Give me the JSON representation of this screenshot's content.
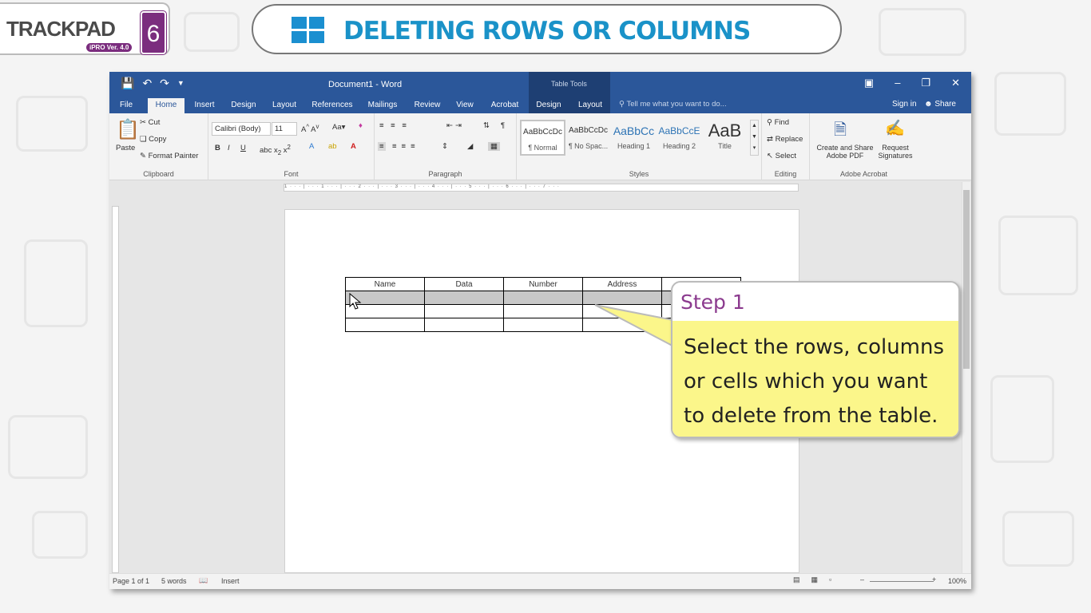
{
  "logo": {
    "brand": "TRACKPAD",
    "sub": "iPRO Ver. 4.0",
    "number": "6"
  },
  "lesson_title": "DELETING ROWS OR COLUMNS",
  "word": {
    "doc_title": "Document1 - Word",
    "contextual_label": "Table Tools",
    "tabs": [
      "File",
      "Home",
      "Insert",
      "Design",
      "Layout",
      "References",
      "Mailings",
      "Review",
      "View",
      "Acrobat",
      "Design",
      "Layout"
    ],
    "tell_me": "Tell me what you want to do...",
    "sign_in": "Sign in",
    "share": "Share",
    "clipboard": {
      "paste": "Paste",
      "cut": "Cut",
      "copy": "Copy",
      "format_painter": "Format Painter",
      "label": "Clipboard"
    },
    "font": {
      "name": "Calibri (Body)",
      "size": "11",
      "label": "Font"
    },
    "paragraph": {
      "label": "Paragraph"
    },
    "styles": {
      "items": [
        {
          "preview": "AaBbCcDc",
          "name": "¶ Normal"
        },
        {
          "preview": "AaBbCcDc",
          "name": "¶ No Spac..."
        },
        {
          "preview": "AaBbCc",
          "name": "Heading 1"
        },
        {
          "preview": "AaBbCcE",
          "name": "Heading 2"
        },
        {
          "preview": "AaB",
          "name": "Title"
        }
      ],
      "label": "Styles"
    },
    "editing": {
      "find": "Find",
      "replace": "Replace",
      "select": "Select",
      "label": "Editing"
    },
    "acrobat": {
      "create": "Create and Share Adobe PDF",
      "request": "Request Signatures",
      "label": "Adobe Acrobat"
    },
    "table": {
      "headers": [
        "Name",
        "Data",
        "Number",
        "Address",
        ""
      ],
      "rows": 3
    },
    "status": {
      "page": "Page 1 of 1",
      "words": "5 words",
      "mode": "Insert",
      "zoom": "100%"
    }
  },
  "callout": {
    "title": "Step 1",
    "body": "Select the rows, columns or cells which you want to delete from the table."
  }
}
